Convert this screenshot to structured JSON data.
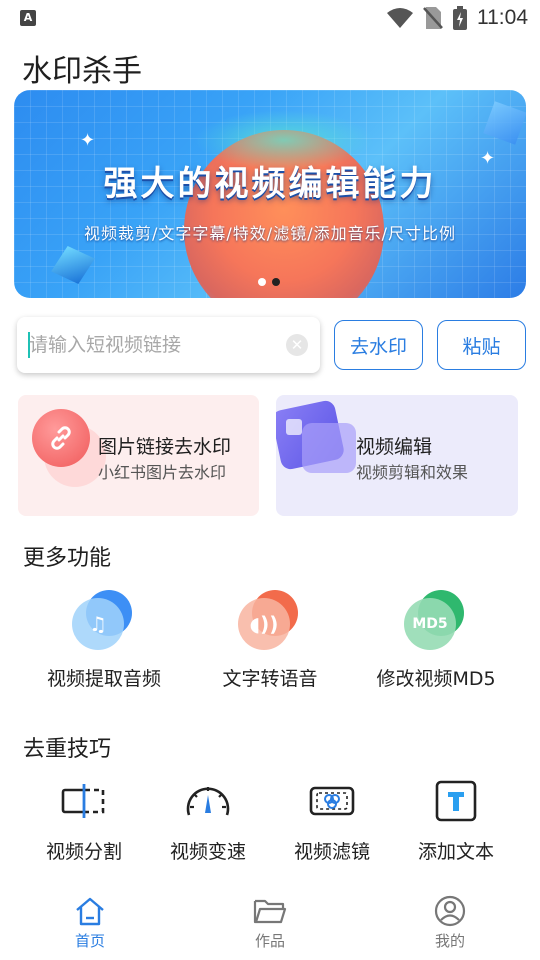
{
  "status_bar": {
    "time": "11:04",
    "indicator_letter": "A"
  },
  "app": {
    "title": "水印杀手"
  },
  "banner": {
    "headline": "强大的视频编辑能力",
    "subtitle": "视频裁剪/文字字幕/特效/滤镜/添加音乐/尺寸比例",
    "page_count": 2,
    "active_page": 2
  },
  "url_input": {
    "placeholder": "请输入短视频链接",
    "value": ""
  },
  "actions": {
    "remove_watermark": "去水印",
    "paste": "粘贴"
  },
  "cards": [
    {
      "title": "图片链接去水印",
      "subtitle": "小红书图片去水印"
    },
    {
      "title": "视频编辑",
      "subtitle": "视频剪辑和效果"
    }
  ],
  "more_features": {
    "title": "更多功能",
    "items": [
      {
        "label": "视频提取音频",
        "icon": "music-note-icon"
      },
      {
        "label": "文字转语音",
        "icon": "sound-wave-icon"
      },
      {
        "label": "修改视频MD5",
        "icon": "md5-icon",
        "badge": "MD5"
      }
    ]
  },
  "tips": {
    "title": "去重技巧",
    "items": [
      {
        "label": "视频分割",
        "icon": "split-icon"
      },
      {
        "label": "视频变速",
        "icon": "speedometer-icon"
      },
      {
        "label": "视频滤镜",
        "icon": "filter-icon"
      },
      {
        "label": "添加文本",
        "icon": "text-icon"
      }
    ]
  },
  "bottom_nav": {
    "items": [
      {
        "label": "首页",
        "icon": "home-icon",
        "active": true
      },
      {
        "label": "作品",
        "icon": "folder-icon",
        "active": false
      },
      {
        "label": "我的",
        "icon": "profile-icon",
        "active": false
      }
    ]
  },
  "colors": {
    "accent": "#2a7de1",
    "caret": "#1ec1b5"
  }
}
